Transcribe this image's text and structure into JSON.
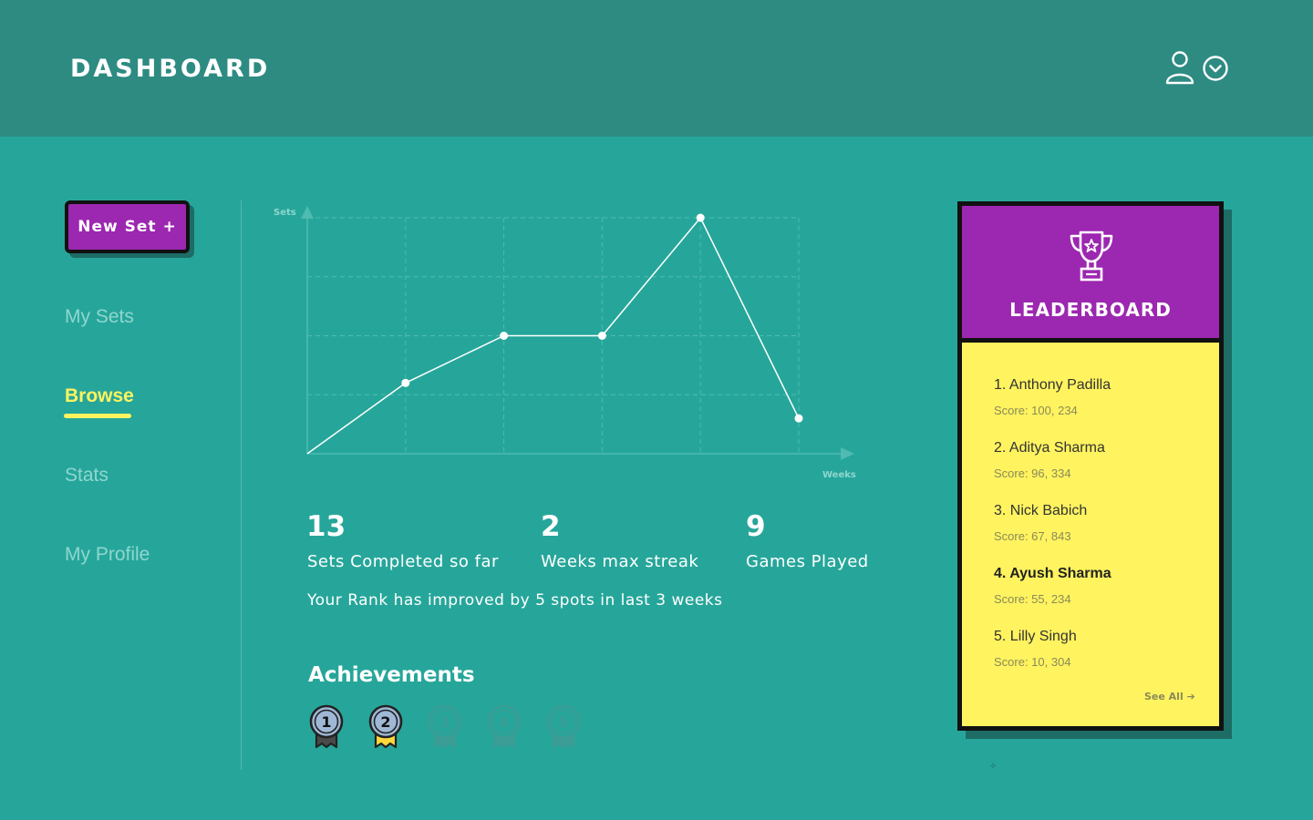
{
  "header": {
    "title": "DASHBOARD",
    "user_icon": "user-icon",
    "dropdown_icon": "chevron-down-circle-icon"
  },
  "sidebar": {
    "new_set_label": "New Set +",
    "items": [
      {
        "label": "My Sets",
        "active": false
      },
      {
        "label": "Browse",
        "active": true
      },
      {
        "label": "Stats",
        "active": false
      },
      {
        "label": "My Profile",
        "active": false
      }
    ]
  },
  "chart_data": {
    "type": "line",
    "ylabel": "Sets",
    "xlabel": "Weeks",
    "x": [
      0,
      1,
      2,
      3,
      4,
      5
    ],
    "values": [
      0,
      3,
      5,
      5,
      10,
      1.5
    ],
    "xlim": [
      0,
      5
    ],
    "ylim": [
      0,
      10
    ],
    "grid": true
  },
  "stats": [
    {
      "value": "13",
      "label": "Sets Completed so far"
    },
    {
      "value": "2",
      "label": "Weeks max streak"
    },
    {
      "value": "9",
      "label": "Games Played"
    }
  ],
  "rank_message": "Your Rank has improved by 5 spots in last 3 weeks",
  "achievements": {
    "title": "Achievements",
    "medals": [
      {
        "number": "1",
        "earned": true,
        "ribbon": "#4a4a4a"
      },
      {
        "number": "2",
        "earned": true,
        "ribbon": "#ffd83a"
      },
      {
        "number": "3",
        "earned": false
      },
      {
        "number": "4",
        "earned": false
      },
      {
        "number": "5",
        "earned": false
      }
    ]
  },
  "leaderboard": {
    "title": "LEADERBOARD",
    "entries": [
      {
        "name": "1. Anthony Padilla",
        "score": "Score: 100, 234",
        "highlight": false
      },
      {
        "name": "2. Aditya Sharma",
        "score": "Score: 96, 334",
        "highlight": false
      },
      {
        "name": "3. Nick Babich",
        "score": "Score: 67, 843",
        "highlight": false
      },
      {
        "name": "4. Ayush Sharma",
        "score": "Score: 55, 234",
        "highlight": true
      },
      {
        "name": "5. Lilly Singh",
        "score": "Score: 10, 304",
        "highlight": false
      }
    ],
    "see_all": "See All ➔"
  },
  "colors": {
    "background": "#26a69a",
    "header": "#2d8b82",
    "accent_purple": "#9c27b0",
    "accent_yellow": "#fff35f"
  }
}
